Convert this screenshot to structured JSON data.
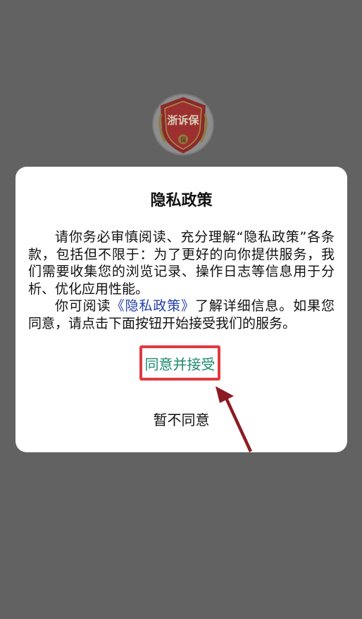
{
  "logo": {
    "text": "浙诉保",
    "badge": "保"
  },
  "dialog": {
    "title": "隐私政策",
    "paragraph1": "请你务必审慎阅读、充分理解“隐私政策”各条款，包括但不限于：为了更好的向你提供服务，我们需要收集您的浏览记录、操作日志等信息用于分析、优化应用性能。",
    "paragraph2_prefix": "你可阅读",
    "policy_link": "《隐私政策》",
    "paragraph2_suffix": "了解详细信息。如果您同意，请点击下面按钮开始接受我们的服务。",
    "accept_label": "同意并接受",
    "decline_label": "暂不同意"
  },
  "colors": {
    "overlay": "#626262",
    "link": "#2140a8",
    "accept_text": "#1d8a6f",
    "highlight_border": "#e03a3e",
    "arrow": "#8b1c22"
  }
}
